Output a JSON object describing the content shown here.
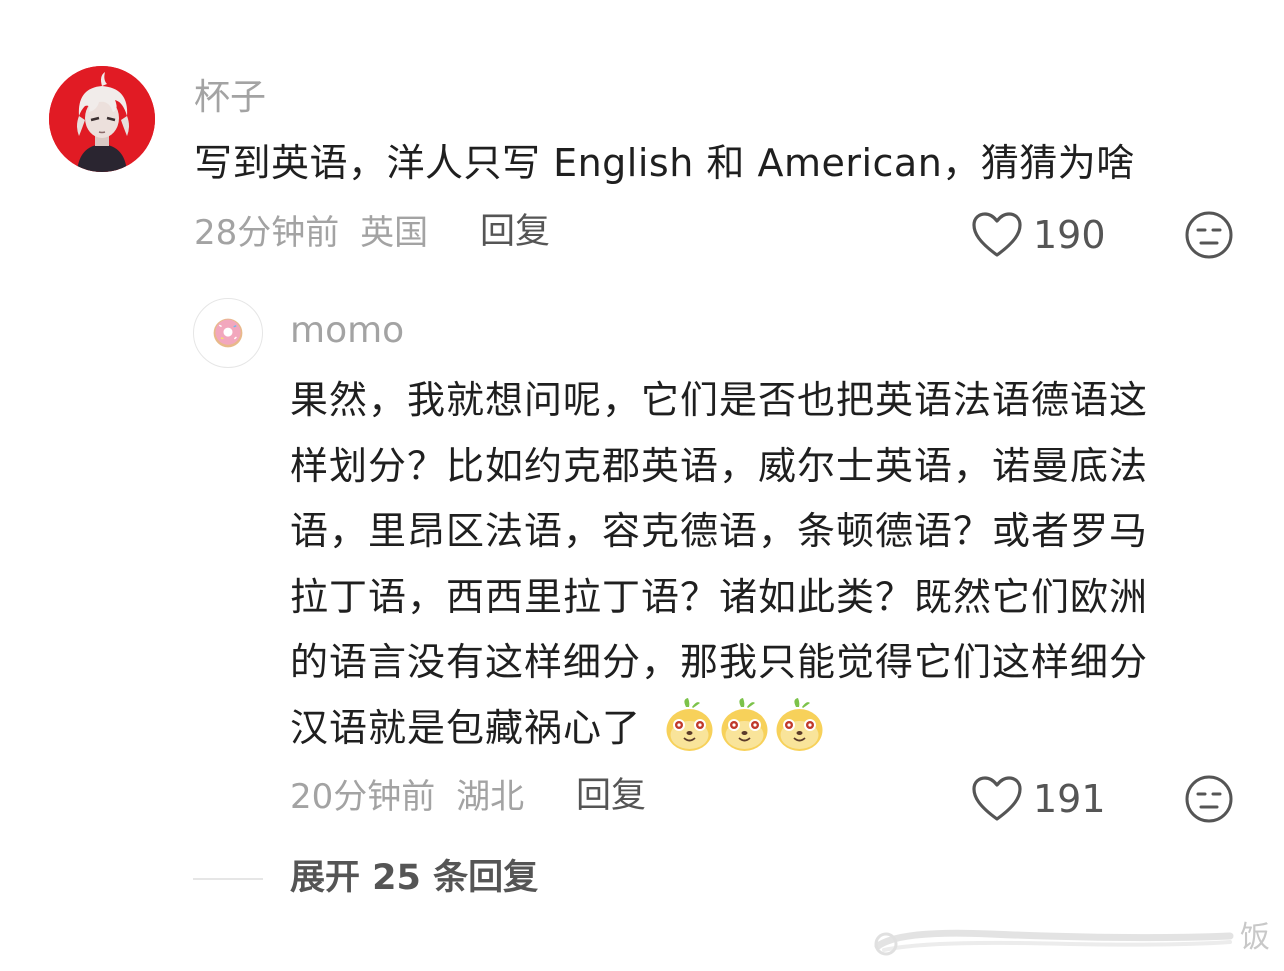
{
  "comment": {
    "username": "杯子",
    "text": "写到英语，洋人只写 English 和 American，猜猜为啥",
    "time": "28分钟前",
    "location": "英国",
    "reply_label": "回复",
    "likes": "190",
    "avatar_icon": "anime-character-avatar",
    "avatar_bg": "#e11b24"
  },
  "reply": {
    "username": "momo",
    "lines": [
      "果然，我就想问呢，它们是否也把英语法语德语这",
      "样划分？比如约克郡英语，威尔士英语，诺曼底法",
      "语，里昂区法语，容克德语，条顿德语？或者罗马",
      "拉丁语，西西里拉丁语？诸如此类？既然它们欧洲",
      "的语言没有这样细分，那我只能觉得它们这样细分",
      "汉语就是包藏祸心了"
    ],
    "emoji_icon": "dog-face-emoji",
    "emoji_count": 3,
    "time": "20分钟前",
    "location": "湖北",
    "reply_label": "回复",
    "likes": "191",
    "avatar_icon": "donut-avatar"
  },
  "expand": {
    "label": "展开 25 条回复"
  },
  "watermark": {
    "text": "饭"
  },
  "colors": {
    "text": "#1f1f1f",
    "muted": "#a3a3a3",
    "action": "#555555"
  }
}
